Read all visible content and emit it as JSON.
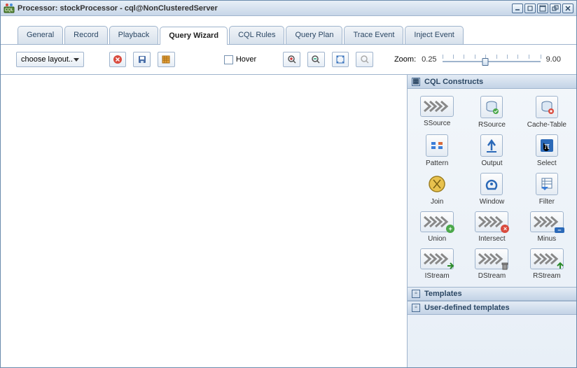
{
  "window": {
    "title": "Processor: stockProcessor - cql@NonClusteredServer"
  },
  "tabs": [
    {
      "id": "general",
      "label": "General",
      "active": false
    },
    {
      "id": "record",
      "label": "Record",
      "active": false
    },
    {
      "id": "playback",
      "label": "Playback",
      "active": false
    },
    {
      "id": "query-wizard",
      "label": "Query Wizard",
      "active": true
    },
    {
      "id": "cql-rules",
      "label": "CQL Rules",
      "active": false
    },
    {
      "id": "query-plan",
      "label": "Query Plan",
      "active": false
    },
    {
      "id": "trace-event",
      "label": "Trace Event",
      "active": false
    },
    {
      "id": "inject-event",
      "label": "Inject Event",
      "active": false
    }
  ],
  "toolbar": {
    "layout_selected": "choose layout..",
    "hover_label": "Hover",
    "hover_checked": false,
    "zoom_label": "Zoom:",
    "zoom_min": "0.25",
    "zoom_max": "9.00"
  },
  "sidepanel": {
    "sections": {
      "constructs": {
        "title": "CQL Constructs"
      },
      "templates": {
        "title": "Templates"
      },
      "user_templates": {
        "title": "User-defined templates"
      }
    },
    "constructs": [
      {
        "id": "ssource",
        "label": "SSource",
        "style": "chevrons",
        "badge": null
      },
      {
        "id": "rsource",
        "label": "RSource",
        "style": "square",
        "badge": "db-green"
      },
      {
        "id": "cache-table",
        "label": "Cache-Table",
        "style": "square",
        "badge": "db-red"
      },
      {
        "id": "pattern",
        "label": "Pattern",
        "style": "square",
        "badge": null
      },
      {
        "id": "output",
        "label": "Output",
        "style": "square",
        "badge": null
      },
      {
        "id": "select",
        "label": "Select",
        "style": "square",
        "badge": null
      },
      {
        "id": "join",
        "label": "Join",
        "style": "join",
        "badge": null
      },
      {
        "id": "window",
        "label": "Window",
        "style": "square",
        "badge": null
      },
      {
        "id": "filter",
        "label": "Filter",
        "style": "square",
        "badge": null
      },
      {
        "id": "union",
        "label": "Union",
        "style": "chevrons",
        "badge": "green-plus"
      },
      {
        "id": "intersect",
        "label": "Intersect",
        "style": "chevrons",
        "badge": "red-x"
      },
      {
        "id": "minus",
        "label": "Minus",
        "style": "chevrons",
        "badge": "blue-minus"
      },
      {
        "id": "istream",
        "label": "IStream",
        "style": "chevrons",
        "badge": "green-arrow"
      },
      {
        "id": "dstream",
        "label": "DStream",
        "style": "chevrons",
        "badge": "trash"
      },
      {
        "id": "rstream",
        "label": "RStream",
        "style": "chevrons",
        "badge": "green-up"
      }
    ]
  }
}
